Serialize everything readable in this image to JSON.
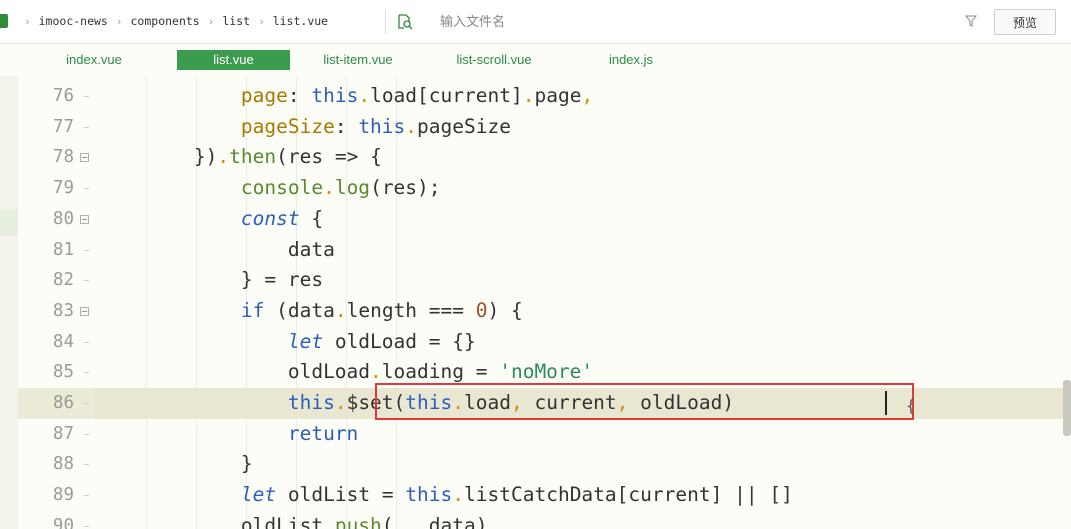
{
  "toolbar": {
    "breadcrumb": [
      "imooc-news",
      "components",
      "list",
      "list.vue"
    ],
    "file_search_placeholder": "输入文件名",
    "preview_label": "预览"
  },
  "tabs": [
    {
      "label": "index.vue",
      "active": false
    },
    {
      "label": "list.vue",
      "active": true
    },
    {
      "label": "list-item.vue",
      "active": false
    },
    {
      "label": "list-scroll.vue",
      "active": false
    },
    {
      "label": "index.js",
      "active": false
    }
  ],
  "editor": {
    "current_line": 86,
    "lines": [
      {
        "num": "76",
        "fold": false
      },
      {
        "num": "77",
        "fold": false
      },
      {
        "num": "78",
        "fold": true
      },
      {
        "num": "79",
        "fold": false
      },
      {
        "num": "80",
        "fold": true
      },
      {
        "num": "81",
        "fold": false
      },
      {
        "num": "82",
        "fold": false
      },
      {
        "num": "83",
        "fold": true
      },
      {
        "num": "84",
        "fold": false
      },
      {
        "num": "85",
        "fold": false
      },
      {
        "num": "86",
        "fold": false
      },
      {
        "num": "87",
        "fold": false
      },
      {
        "num": "88",
        "fold": false
      },
      {
        "num": "89",
        "fold": false
      },
      {
        "num": "90",
        "fold": false
      }
    ],
    "code": [
      "            page: this.load[current].page,",
      "            pageSize: this.pageSize",
      "        }).then(res => {",
      "            console.log(res);",
      "            const {",
      "                data",
      "            } = res",
      "            if (data.length === 0) {",
      "                let oldLoad = {}",
      "                oldLoad.loading = 'noMore'",
      "                this.$set(this.load, current, oldLoad)",
      "                return",
      "            }",
      "            let oldList = this.listCatchData[current] || []",
      "            oldList.push(...data)"
    ]
  },
  "colors": {
    "accent": "#3b9c4e",
    "highlight_box": "#e03a3a"
  }
}
